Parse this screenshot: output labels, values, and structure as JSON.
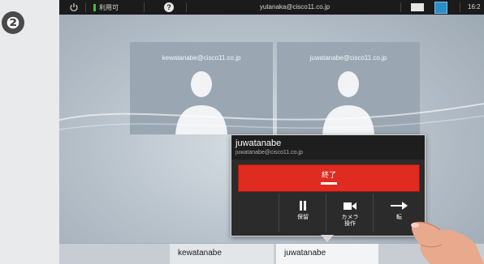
{
  "step": {
    "number": "❷"
  },
  "status_bar": {
    "availability": "利用可",
    "help_label": "?",
    "account": "yutanaka@cisco11.co.jp",
    "time": "16:2"
  },
  "participants": [
    {
      "address": "kewatanabe@cisco11.co.jp"
    },
    {
      "address": "juwatanabe@cisco11.co.jp"
    }
  ],
  "call_popup": {
    "name": "juwatanabe",
    "address": "juwatanabe@cisco11.co.jp",
    "end_label": "終了",
    "controls": {
      "hold_label": "保留",
      "camera_label_line1": "カメラ",
      "camera_label_line2": "操作",
      "transfer_label": "転"
    }
  },
  "bottom_tabs": [
    "kewatanabe",
    "juwatanabe"
  ],
  "colors": {
    "end_button": "#e02b20",
    "status_green": "#3cc13c",
    "layout_blue": "#2a8ec9"
  }
}
